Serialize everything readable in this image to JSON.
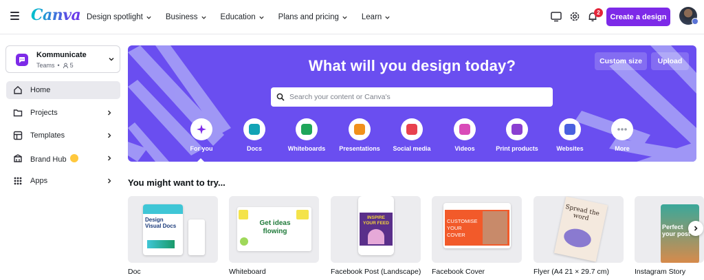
{
  "app": {
    "logo": "Canva"
  },
  "nav": [
    {
      "label": "Design spotlight"
    },
    {
      "label": "Business"
    },
    {
      "label": "Education"
    },
    {
      "label": "Plans and pricing"
    },
    {
      "label": "Learn"
    }
  ],
  "header": {
    "notification_count": "2",
    "create_label": "Create a design"
  },
  "team": {
    "name": "Kommunicate",
    "plan": "Teams",
    "members": "5"
  },
  "sidebar": {
    "items": [
      {
        "label": "Home"
      },
      {
        "label": "Projects"
      },
      {
        "label": "Templates"
      },
      {
        "label": "Brand Hub"
      },
      {
        "label": "Apps"
      }
    ]
  },
  "hero": {
    "title": "What will you design today?",
    "custom_size_label": "Custom size",
    "upload_label": "Upload",
    "search_placeholder": "Search your content or Canva's",
    "categories": [
      {
        "label": "For you",
        "icon": "sparkle-icon",
        "color": "#7d2ae8"
      },
      {
        "label": "Docs",
        "icon": "doc-icon",
        "color": "#13a3b5"
      },
      {
        "label": "Whiteboards",
        "icon": "whiteboard-icon",
        "color": "#1fa55a"
      },
      {
        "label": "Presentations",
        "icon": "presentation-icon",
        "color": "#f0901d"
      },
      {
        "label": "Social media",
        "icon": "heart-icon",
        "color": "#e8414f"
      },
      {
        "label": "Videos",
        "icon": "video-icon",
        "color": "#d94bb8"
      },
      {
        "label": "Print products",
        "icon": "print-icon",
        "color": "#8a3fd1"
      },
      {
        "label": "Websites",
        "icon": "website-icon",
        "color": "#4a5fe0"
      },
      {
        "label": "More",
        "icon": "more-icon",
        "color": "#9aa0aa"
      }
    ]
  },
  "suggestions": {
    "title": "You might want to try...",
    "items": [
      {
        "label": "Doc",
        "thumb_text": "Design Visual Docs"
      },
      {
        "label": "Whiteboard",
        "thumb_text": "Get ideas flowing"
      },
      {
        "label": "Facebook Post (Landscape)",
        "thumb_text": "INSPIRE YOUR FEED"
      },
      {
        "label": "Facebook Cover",
        "thumb_text": "CUSTOMISE YOUR COVER"
      },
      {
        "label": "Flyer (A4 21 × 29.7 cm)",
        "thumb_text": "Spread the word"
      },
      {
        "label": "Instagram Story",
        "thumb_text": "Perfect your post"
      }
    ]
  },
  "colors": {
    "brand_purple": "#7d2ae8",
    "hero_bg": "#6a4ef0",
    "notification_red": "#e3253a"
  }
}
